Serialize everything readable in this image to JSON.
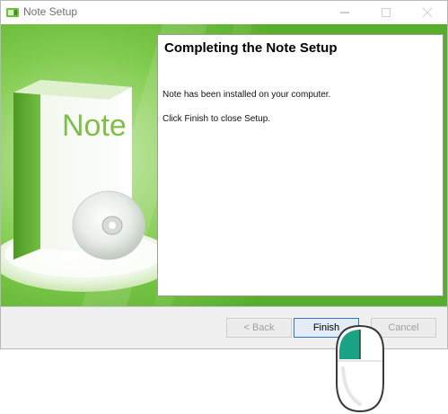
{
  "window": {
    "title": "Note Setup"
  },
  "hero": {
    "box_brand": "Note"
  },
  "panel": {
    "heading": "Completing the Note Setup",
    "line1": "Note has been installed on your computer.",
    "line2": "Click Finish to close Setup."
  },
  "buttons": {
    "back_label": "< Back",
    "finish_label": "Finish",
    "cancel_label": "Cancel"
  },
  "icons": {
    "app": "app-icon",
    "minimize": "minimize-icon",
    "maximize": "maximize-icon",
    "close": "close-icon",
    "mouse": "mouse-left-click-icon"
  },
  "colors": {
    "brand_green": "#59ad2c",
    "finish_border": "#2f76c8",
    "mouse_accent": "#1aa385"
  }
}
